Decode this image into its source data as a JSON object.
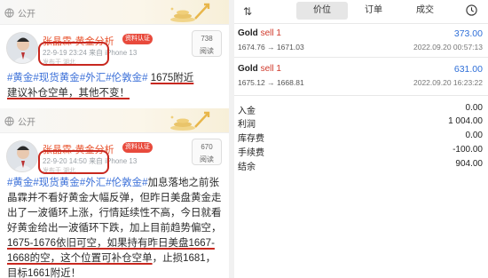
{
  "posts": [
    {
      "visibility": "公开",
      "author": "张晶霖-黄金分析",
      "badge": "资料认证",
      "time": "22-9-19 23:24",
      "device": "来自 iPhone 13",
      "location": "发布于 湖北",
      "views": "738",
      "views_label": "阅读",
      "tags": [
        "#黄金",
        "#现货黄金",
        "#外汇",
        "#伦敦金#"
      ],
      "highlight": "1675附近",
      "text_rest": "建议补仓空单，其他不变！"
    },
    {
      "visibility": "公开",
      "author": "张晶霖-黄金分析",
      "badge": "资料认证",
      "time": "22-9-20 14:50",
      "device": "来自 iPhone 13",
      "location": "发布于 湖北",
      "views": "670",
      "views_label": "阅读",
      "tags": [
        "#黄金",
        "#现货黄金",
        "#外汇",
        "#伦敦金#"
      ],
      "text_a": "加息落地之前张晶霖并不看好黄金大幅反弹，但昨日美盘黄金走出了一波循环上涨，行情延续性不高，今日就看好黄金给出一波循环下跌，加上目前趋势偏空，",
      "highlight": "1675-1676依旧可空，如果持有昨日美盘1667-1668的空，这个位置可补仓空单",
      "text_b": "，止损1681，目标1661附近！"
    }
  ],
  "trade": {
    "tabs": [
      "价位",
      "订单",
      "成交"
    ],
    "active_tab": 0,
    "orders": [
      {
        "symbol": "Gold",
        "side": "sell 1",
        "prices": "1674.76 → 1671.03",
        "profit": "373.00",
        "date": "2022.09.20 00:57:13"
      },
      {
        "symbol": "Gold",
        "side": "sell 1",
        "prices": "1675.12 → 1668.81",
        "profit": "631.00",
        "date": "2022.09.20 16:23:22"
      }
    ],
    "summary": [
      {
        "label": "入金",
        "value": "0.00"
      },
      {
        "label": "利润",
        "value": "1 004.00"
      },
      {
        "label": "库存费",
        "value": "0.00"
      },
      {
        "label": "手续费",
        "value": "-100.00"
      },
      {
        "label": "结余",
        "value": "904.00"
      }
    ],
    "colors": {
      "sell": "#d0392b",
      "profit": "#2f6fd8",
      "author": "#e8542f",
      "tag": "#3a6fd8",
      "annotation": "#c8281f"
    }
  }
}
